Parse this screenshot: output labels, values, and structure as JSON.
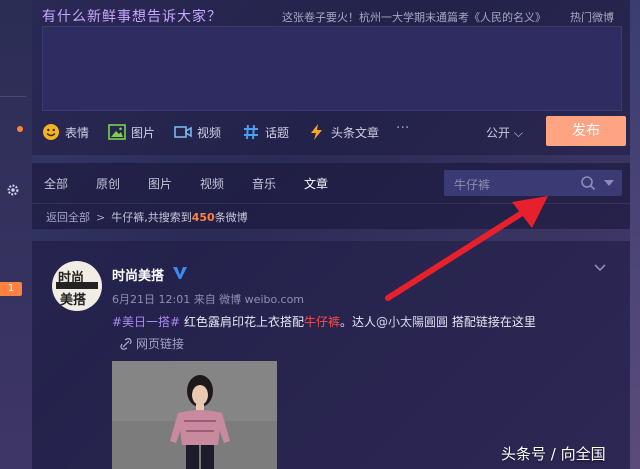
{
  "publisher": {
    "title": "有什么新鲜事想告诉大家？",
    "hot_topic": "这张卷子要火！杭州一大学期末通篇考《人民的名义》",
    "hot_link": "热门微博",
    "tools": [
      {
        "label": "表情",
        "icon": "emoji-icon"
      },
      {
        "label": "图片",
        "icon": "image-icon"
      },
      {
        "label": "视频",
        "icon": "video-icon"
      },
      {
        "label": "话题",
        "icon": "hashtag-icon"
      },
      {
        "label": "头条文章",
        "icon": "lightning-icon"
      }
    ],
    "more": "···",
    "scope": "公开",
    "submit": "发布"
  },
  "filter": {
    "tabs": [
      "全部",
      "原创",
      "图片",
      "视频",
      "音乐",
      "文章"
    ],
    "active_tab": "文章",
    "search_value": "牛仔裤",
    "back_label": "返回全部",
    "result_keyword": "牛仔裤",
    "result_prefix": ",共搜索到",
    "result_count": "450",
    "result_suffix": "条微博"
  },
  "post": {
    "avatar_text_top": "时尚",
    "avatar_text_bottom": "美搭",
    "author": "时尚美搭",
    "meta": "6月21日 12:01 来自 微博 weibo.com",
    "hashtag": "#美日一搭#",
    "text_a": " 红色露肩印花上衣搭配",
    "keyword": "牛仔裤",
    "text_b": "。达人",
    "mention": "@小太陽圓圓",
    "text_c": " 搭配链接在这里",
    "link_label": "网页链接"
  },
  "watermark": "头条号 / 向全国",
  "gutter_badge": "1",
  "colors": {
    "accent_orange": "#ff8140",
    "publish_button": "#ffa483",
    "keyword_red": "#ff4a4a",
    "hashtag_purple": "#a88af0",
    "arrow_red": "#e8202c"
  }
}
